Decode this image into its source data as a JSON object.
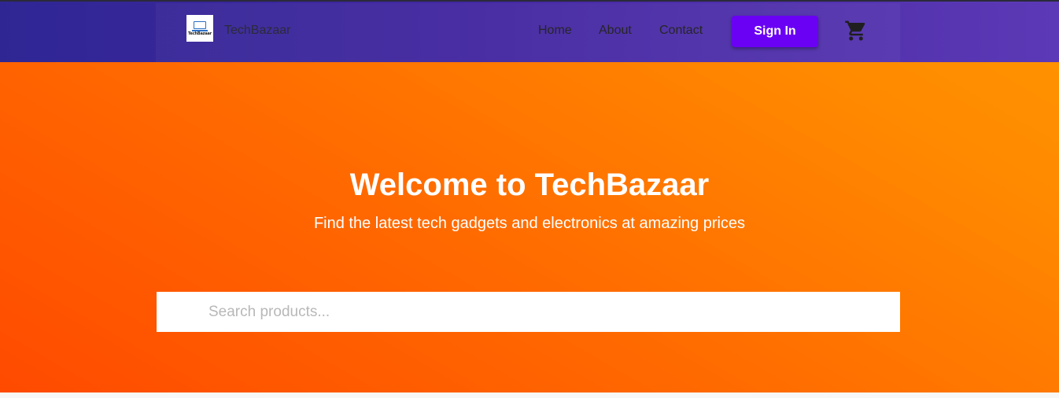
{
  "navbar": {
    "logo_text": "TechBazaar",
    "brand_name": "TechBazaar",
    "links": [
      {
        "label": "Home"
      },
      {
        "label": "About"
      },
      {
        "label": "Contact"
      }
    ],
    "signin_label": "Sign In",
    "cart_icon": "shopping-cart-icon"
  },
  "hero": {
    "title": "Welcome to TechBazaar",
    "subtitle": "Find the latest tech gadgets and electronics at amazing prices"
  },
  "search": {
    "placeholder": "Search products...",
    "value": ""
  },
  "colors": {
    "navbar_start": "#2f2694",
    "navbar_end": "#5c39b6",
    "signin_button": "#6a00f4",
    "hero_start": "#ff4a00",
    "hero_end": "#ff9200"
  }
}
